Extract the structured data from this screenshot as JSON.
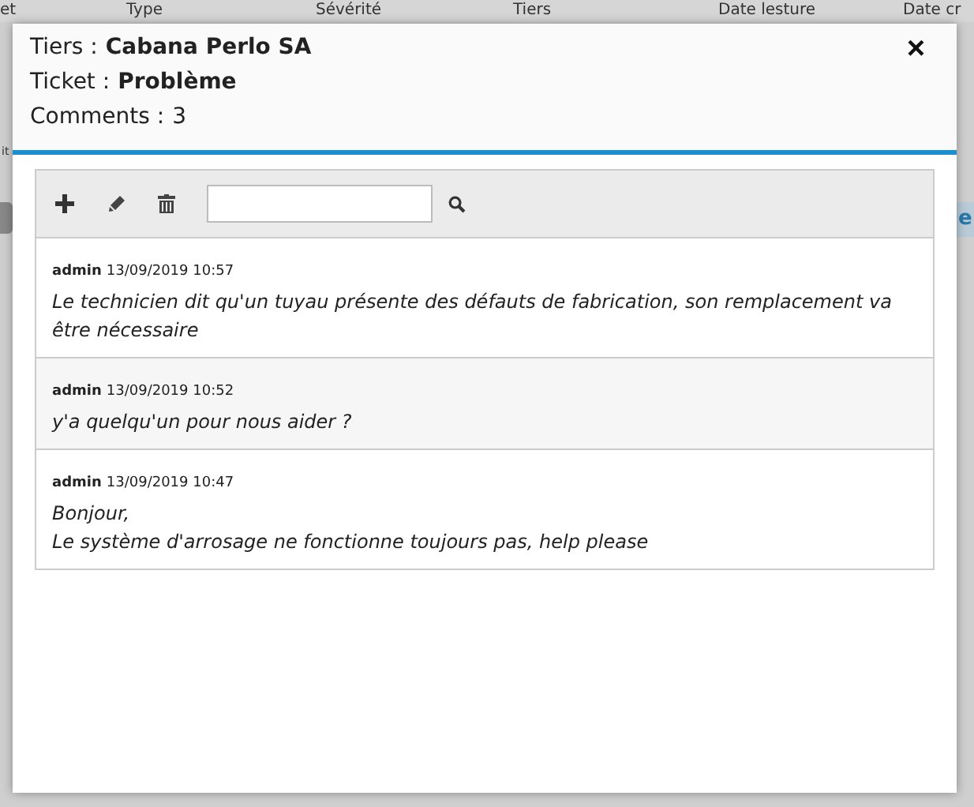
{
  "backdrop": {
    "columns": [
      "et",
      "Type",
      "Sévérité",
      "Tiers",
      "Date lesture",
      "Date cr"
    ],
    "side_label": "it",
    "side_button": "e"
  },
  "dialog": {
    "fields": [
      {
        "label": "Tiers :",
        "value": "Cabana Perlo SA",
        "bold": true
      },
      {
        "label": "Ticket :",
        "value": "Problème",
        "bold": true
      },
      {
        "label": "Comments :",
        "value": "3",
        "bold": false
      }
    ],
    "close": "×"
  },
  "comments": [
    {
      "author": "admin",
      "date": "13/09/2019 10:57",
      "lines": [
        "Le technicien dit qu'un tuyau présente des défauts de fabrication, son remplacement va être nécessaire"
      ]
    },
    {
      "author": "admin",
      "date": "13/09/2019 10:52",
      "lines": [
        "y'a quelqu'un pour nous aider ?"
      ]
    },
    {
      "author": "admin",
      "date": "13/09/2019 10:47",
      "lines": [
        "Bonjour,",
        "Le système d'arrosage ne fonctionne toujours pas, help please"
      ]
    }
  ]
}
